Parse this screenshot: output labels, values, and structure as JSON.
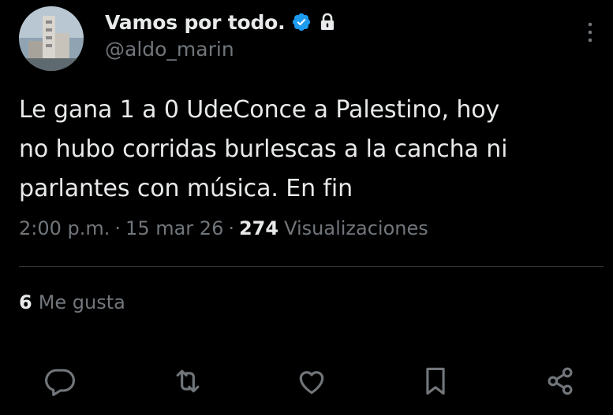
{
  "author": {
    "display_name": "Vamos por todo.",
    "handle": "@aldo_marin",
    "verified": true,
    "protected": true,
    "avatar_icon": "avatar-building-photo"
  },
  "tweet": {
    "text_lines": [
      "Le gana 1 a 0 UdeConce a Palestino, hoy",
      "no hubo corridas burlescas a la cancha ni",
      "parlantes con música. En fin"
    ]
  },
  "meta": {
    "time": "2:00 p.m.",
    "separator": "·",
    "date": "15 mar 26",
    "views_count": "274",
    "views_label": "Visualizaciones"
  },
  "stats": {
    "likes_count": "6",
    "likes_label": "Me gusta"
  },
  "actions": [
    {
      "icon": "reply-icon"
    },
    {
      "icon": "retweet-icon"
    },
    {
      "icon": "like-icon"
    },
    {
      "icon": "bookmark-icon"
    },
    {
      "icon": "share-icon"
    }
  ],
  "colors": {
    "background": "#000000",
    "primary_text": "#e7e9ea",
    "secondary_text": "#71767b",
    "verified_badge": "#1d9bf0",
    "divider": "#2f3336"
  }
}
